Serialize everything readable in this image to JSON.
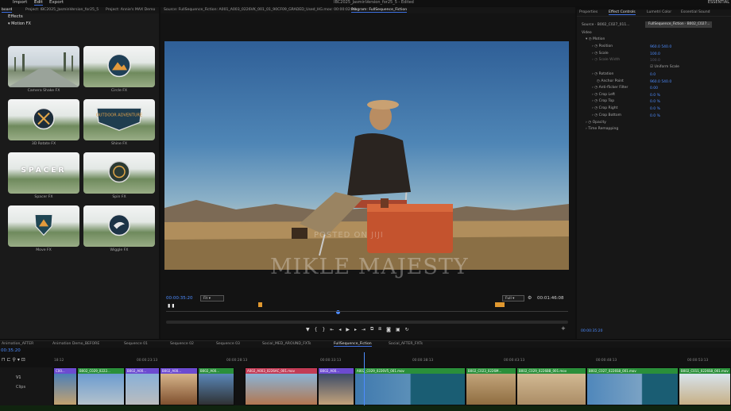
{
  "menu": {
    "items": [
      "Import",
      "Edit",
      "Export"
    ],
    "active": "Edit",
    "title": "IBC2025_JasminVersion_for25_5 - Edited",
    "workspace": "ESSENTIAL"
  },
  "left_tabs": [
    "board",
    "Project: IBC2025_JasminVersion_for25_5",
    "Project: Annie's MAX Demo"
  ],
  "effects": {
    "heading": "Effects",
    "folder": "Motion FX",
    "cards": [
      {
        "label": "Camera Shake FX",
        "thumb": "snow-road",
        "badge": ""
      },
      {
        "label": "Circle FX",
        "thumb": "forest",
        "badge": "circle-logo"
      },
      {
        "label": "3D Rotate FX",
        "thumb": "forest",
        "badge": "axes-logo"
      },
      {
        "label": "Shine FX",
        "thumb": "forest",
        "badge": "shield-logo",
        "badge_text": "OUTDOOR ADVENTURE"
      },
      {
        "label": "Spacer FX",
        "thumb": "forest",
        "badge": "text",
        "badge_text": "SPACER"
      },
      {
        "label": "Spin FX",
        "thumb": "forest",
        "badge": "spin-logo"
      },
      {
        "label": "Move FX",
        "thumb": "forest",
        "badge": "shield-logo-small"
      },
      {
        "label": "Wiggle FX",
        "thumb": "forest",
        "badge": "bird-logo"
      }
    ]
  },
  "monitor_tabs": [
    "Source: FullSequence_Fiction: A001_A003_0226VK_001_01_90CF09_GRADED_Used_HG.mov: 00:00:02:10",
    "Program: FullSequence_Fiction"
  ],
  "program": {
    "timecode_left": "00:00:35:20",
    "fit_label": "Fit",
    "quality_label": "Full",
    "timecode_right": "00:01:46:08",
    "watermark_small": "POSTED ON JIJI",
    "watermark_large": "MIKLE MAJESTY"
  },
  "right_tabs": [
    "Properties",
    "Effect Controls",
    "Lumetri Color",
    "Essential Sound"
  ],
  "effect_controls": {
    "source": "Source · B002_C027_011...",
    "clip": "FullSequence_Fiction · B002_C027...",
    "rows": [
      {
        "label": "Video",
        "value": ""
      },
      {
        "label": "Motion",
        "value": ""
      },
      {
        "label": "Position",
        "value": "960.0   540.0"
      },
      {
        "label": "Scale",
        "value": "100.0"
      },
      {
        "label": "Scale Width",
        "value": "100.0"
      },
      {
        "label": "Uniform Scale",
        "value": ""
      },
      {
        "label": "Rotation",
        "value": "0.0"
      },
      {
        "label": "Anchor Point",
        "value": "960.0   540.0"
      },
      {
        "label": "Anti-flicker Filter",
        "value": "0.00"
      },
      {
        "label": "Crop Left",
        "value": "0.0 %"
      },
      {
        "label": "Crop Top",
        "value": "0.0 %"
      },
      {
        "label": "Crop Right",
        "value": "0.0 %"
      },
      {
        "label": "Crop Bottom",
        "value": "0.0 %"
      },
      {
        "label": "Opacity",
        "value": ""
      },
      {
        "label": "Time Remapping",
        "value": ""
      }
    ],
    "footer_tc": "00:00:35:20"
  },
  "timeline_tabs": [
    "Animation_AFTER",
    "Animation Demo_BEFORE",
    "Sequence 01",
    "Sequence 02",
    "Sequence 03",
    "Social_MED_AROUND_FXTs",
    "FullSequence_Fiction",
    "Social_AFTER_FXTs"
  ],
  "timeline": {
    "timecode": "00:35:20",
    "ticks": [
      "18:12",
      "00:00:23:13",
      "00:00:28:13",
      "00:00:33:13",
      "00:00:38:13",
      "00:00:43:13",
      "00:00:48:13",
      "00:00:53:13"
    ],
    "track_label": "V1",
    "track_name": "Clips",
    "clips": [
      {
        "name": "C00...",
        "color": "#6c4bd1"
      },
      {
        "name": "B002_C029_0222...",
        "color": "#2a8f3a"
      },
      {
        "name": "B002_A00...",
        "color": "#6c4bd1"
      },
      {
        "name": "B002_A00...",
        "color": "#6c4bd1"
      },
      {
        "name": "B002_A00...",
        "color": "#2a8f3a"
      },
      {
        "name": "A002_A003_0226AC_001.mov",
        "color": "#c23b55"
      },
      {
        "name": "B002_A00...",
        "color": "#6c4bd1"
      },
      {
        "name": "A002_C029_0226V5_001.mov",
        "color": "#2a8f3a"
      },
      {
        "name": "B002_C023_0226M...",
        "color": "#2a8f3a"
      },
      {
        "name": "B002_C029_0226BB_001.mov",
        "color": "#2a8f3a"
      },
      {
        "name": "B002_C027_0226S8_001.mov",
        "color": "#2a8f3a"
      },
      {
        "name": "B002_C011_0226S8_001.mov",
        "color": "#2a8f3a"
      }
    ]
  }
}
